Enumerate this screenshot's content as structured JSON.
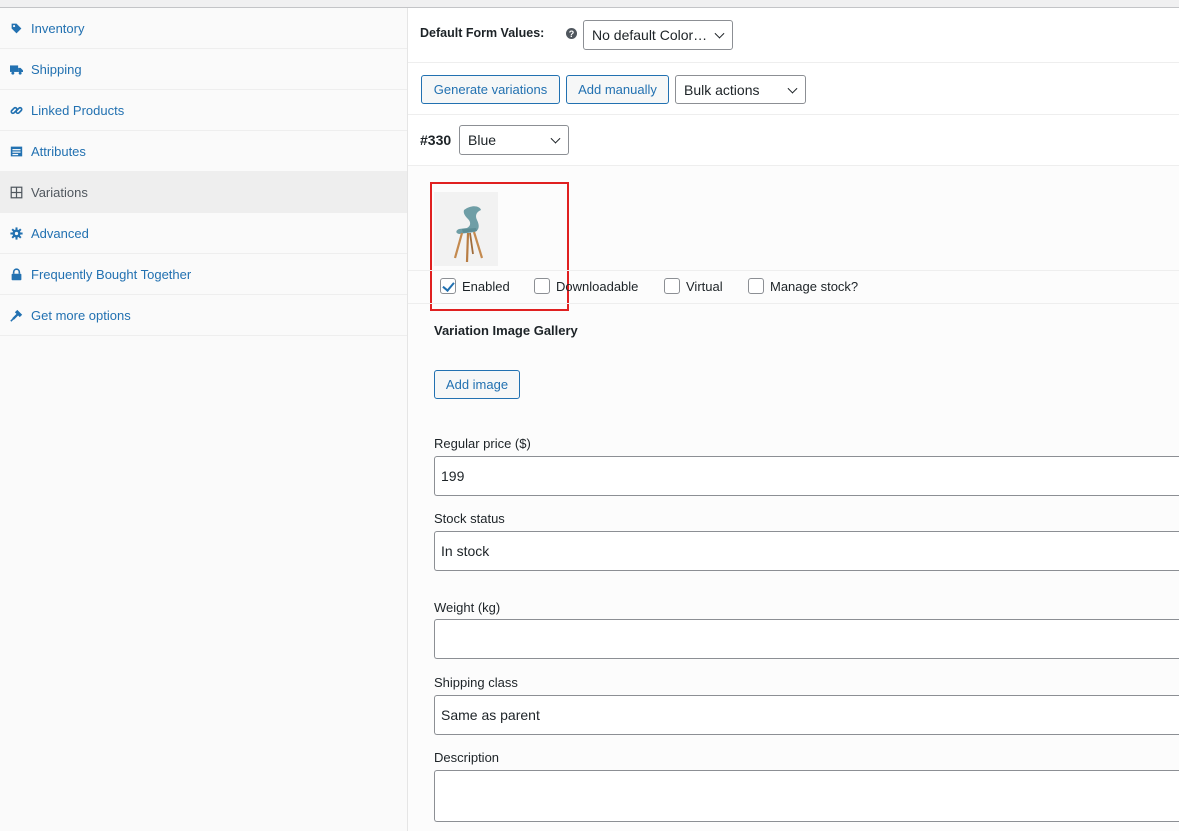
{
  "sidebar": {
    "items": [
      {
        "label": "Inventory",
        "icon": "tag-icon"
      },
      {
        "label": "Shipping",
        "icon": "truck-icon"
      },
      {
        "label": "Linked Products",
        "icon": "link-icon"
      },
      {
        "label": "Attributes",
        "icon": "list-icon"
      },
      {
        "label": "Variations",
        "icon": "grid-icon",
        "active": true
      },
      {
        "label": "Advanced",
        "icon": "gear-icon"
      },
      {
        "label": "Frequently Bought Together",
        "icon": "lock-icon"
      },
      {
        "label": "Get more options",
        "icon": "plugin-icon"
      }
    ]
  },
  "defaults": {
    "label": "Default Form Values:",
    "help": "?",
    "select_value": "No default Color…"
  },
  "actions": {
    "generate": "Generate variations",
    "add_manually": "Add manually",
    "bulk_value": "Bulk actions"
  },
  "variation": {
    "id": "#330",
    "color_value": "Blue",
    "image_alt": "chair",
    "checks": {
      "enabled": {
        "label": "Enabled",
        "checked": true
      },
      "downloadable": {
        "label": "Downloadable",
        "checked": false
      },
      "virtual": {
        "label": "Virtual",
        "checked": false
      },
      "manage_stock": {
        "label": "Manage stock?",
        "checked": false
      }
    },
    "gallery_title": "Variation Image Gallery",
    "add_image": "Add image",
    "regular_price_label": "Regular price ($)",
    "regular_price_value": "199",
    "stock_status_label": "Stock status",
    "stock_status_value": "In stock",
    "weight_label": "Weight (kg)",
    "weight_value": "",
    "shipping_class_label": "Shipping class",
    "shipping_class_value": "Same as parent",
    "description_label": "Description",
    "description_value": ""
  },
  "colors": {
    "link": "#2271b1",
    "highlight": "#e02020"
  }
}
